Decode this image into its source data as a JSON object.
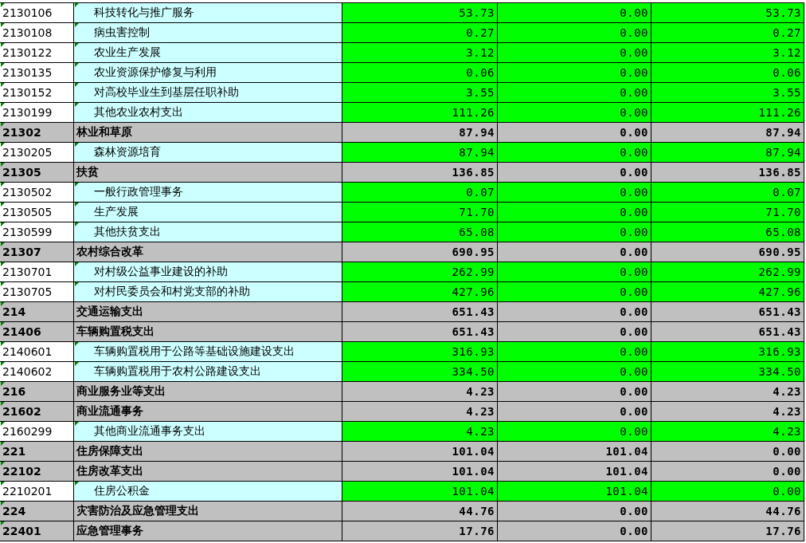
{
  "rows": [
    {
      "kind": "item",
      "code": "2130106",
      "name": "科技转化与推广服务",
      "values": [
        "53.73",
        "0.00",
        "53.73"
      ]
    },
    {
      "kind": "item",
      "code": "2130108",
      "name": "病虫害控制",
      "values": [
        "0.27",
        "0.00",
        "0.27"
      ]
    },
    {
      "kind": "item",
      "code": "2130122",
      "name": "农业生产发展",
      "values": [
        "3.12",
        "0.00",
        "3.12"
      ]
    },
    {
      "kind": "item",
      "code": "2130135",
      "name": "农业资源保护修复与利用",
      "values": [
        "0.06",
        "0.00",
        "0.06"
      ]
    },
    {
      "kind": "item",
      "code": "2130152",
      "name": "对高校毕业生到基层任职补助",
      "values": [
        "3.55",
        "0.00",
        "3.55"
      ]
    },
    {
      "kind": "item",
      "code": "2130199",
      "name": "其他农业农村支出",
      "values": [
        "111.26",
        "0.00",
        "111.26"
      ]
    },
    {
      "kind": "group",
      "code": "21302",
      "name": "林业和草原",
      "values": [
        "87.94",
        "0.00",
        "87.94"
      ]
    },
    {
      "kind": "item",
      "code": "2130205",
      "name": "森林资源培育",
      "values": [
        "87.94",
        "0.00",
        "87.94"
      ]
    },
    {
      "kind": "group",
      "code": "21305",
      "name": "扶贫",
      "values": [
        "136.85",
        "0.00",
        "136.85"
      ]
    },
    {
      "kind": "item",
      "code": "2130502",
      "name": "一般行政管理事务",
      "values": [
        "0.07",
        "0.00",
        "0.07"
      ]
    },
    {
      "kind": "item",
      "code": "2130505",
      "name": "生产发展",
      "values": [
        "71.70",
        "0.00",
        "71.70"
      ]
    },
    {
      "kind": "item",
      "code": "2130599",
      "name": "其他扶贫支出",
      "values": [
        "65.08",
        "0.00",
        "65.08"
      ]
    },
    {
      "kind": "group",
      "code": "21307",
      "name": "农村综合改革",
      "values": [
        "690.95",
        "0.00",
        "690.95"
      ]
    },
    {
      "kind": "item",
      "code": "2130701",
      "name": "对村级公益事业建设的补助",
      "values": [
        "262.99",
        "0.00",
        "262.99"
      ]
    },
    {
      "kind": "item",
      "code": "2130705",
      "name": "对村民委员会和村党支部的补助",
      "values": [
        "427.96",
        "0.00",
        "427.96"
      ]
    },
    {
      "kind": "group",
      "code": "214",
      "name": "交通运输支出",
      "values": [
        "651.43",
        "0.00",
        "651.43"
      ]
    },
    {
      "kind": "group",
      "code": "21406",
      "name": "车辆购置税支出",
      "values": [
        "651.43",
        "0.00",
        "651.43"
      ]
    },
    {
      "kind": "item",
      "code": "2140601",
      "name": "车辆购置税用于公路等基础设施建设支出",
      "values": [
        "316.93",
        "0.00",
        "316.93"
      ]
    },
    {
      "kind": "item",
      "code": "2140602",
      "name": "车辆购置税用于农村公路建设支出",
      "values": [
        "334.50",
        "0.00",
        "334.50"
      ]
    },
    {
      "kind": "group",
      "code": "216",
      "name": "商业服务业等支出",
      "values": [
        "4.23",
        "0.00",
        "4.23"
      ]
    },
    {
      "kind": "group",
      "code": "21602",
      "name": "商业流通事务",
      "values": [
        "4.23",
        "0.00",
        "4.23"
      ]
    },
    {
      "kind": "item",
      "code": "2160299",
      "name": "其他商业流通事务支出",
      "values": [
        "4.23",
        "0.00",
        "4.23"
      ]
    },
    {
      "kind": "group",
      "code": "221",
      "name": "住房保障支出",
      "values": [
        "101.04",
        "101.04",
        "0.00"
      ]
    },
    {
      "kind": "group",
      "code": "22102",
      "name": "住房改革支出",
      "values": [
        "101.04",
        "101.04",
        "0.00"
      ]
    },
    {
      "kind": "item",
      "code": "2210201",
      "name": "住房公积金",
      "values": [
        "101.04",
        "101.04",
        "0.00"
      ]
    },
    {
      "kind": "group",
      "code": "224",
      "name": "灾害防治及应急管理支出",
      "values": [
        "44.76",
        "0.00",
        "44.76"
      ]
    },
    {
      "kind": "group",
      "code": "22401",
      "name": "应急管理事务",
      "values": [
        "17.76",
        "0.00",
        "17.76"
      ]
    }
  ]
}
